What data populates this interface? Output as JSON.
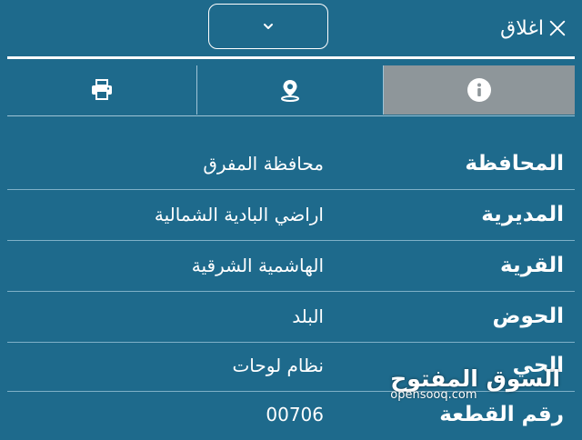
{
  "header": {
    "close_label": "اغلاق",
    "close_icon": "close-icon",
    "dropdown_icon": "chevron-down-icon"
  },
  "tabs": [
    {
      "id": "info",
      "icon": "info-icon",
      "selected": true
    },
    {
      "id": "location",
      "icon": "location-pin-icon",
      "selected": false
    },
    {
      "id": "print",
      "icon": "printer-icon",
      "selected": false
    }
  ],
  "details": [
    {
      "label": "المحافظة",
      "value": "محافظة المفرق"
    },
    {
      "label": "المديرية",
      "value": "اراضي البادية الشمالية"
    },
    {
      "label": "القرية",
      "value": "الهاشمية الشرقية"
    },
    {
      "label": "الحوض",
      "value": "البلد"
    },
    {
      "label": "الحي",
      "value": "نظام لوحات"
    },
    {
      "label": "رقم القطعة",
      "value": "00706"
    }
  ],
  "watermark": {
    "arabic": "السوق المفتوح",
    "latin": "opensooq.com"
  },
  "colors": {
    "background": "#1e6a8c",
    "selected_tab": "#8e969a",
    "text": "#ffffff"
  }
}
